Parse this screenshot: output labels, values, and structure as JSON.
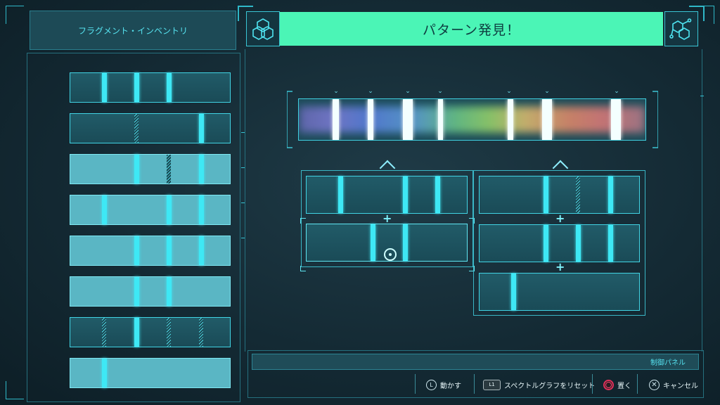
{
  "inventory": {
    "title": "フラグメント・インベントリ"
  },
  "header": {
    "title": "パターン発見！"
  },
  "control_panel": {
    "label": "制御パネル",
    "buttons": [
      {
        "glyph": "L",
        "label": "動かす",
        "icon": "left-stick-icon"
      },
      {
        "glyph": "L1",
        "label": "スペクトルグラフをリセット",
        "icon": "l1-button-icon"
      },
      {
        "glyph": "",
        "label": "置く",
        "icon": "circle-button-icon"
      },
      {
        "glyph": "",
        "label": "キャンセル",
        "icon": "cross-button-icon"
      }
    ]
  },
  "colors": {
    "accent": "#3ee8f5",
    "header_bg": "#4bf5b6",
    "circle_button": "#e0305a"
  }
}
